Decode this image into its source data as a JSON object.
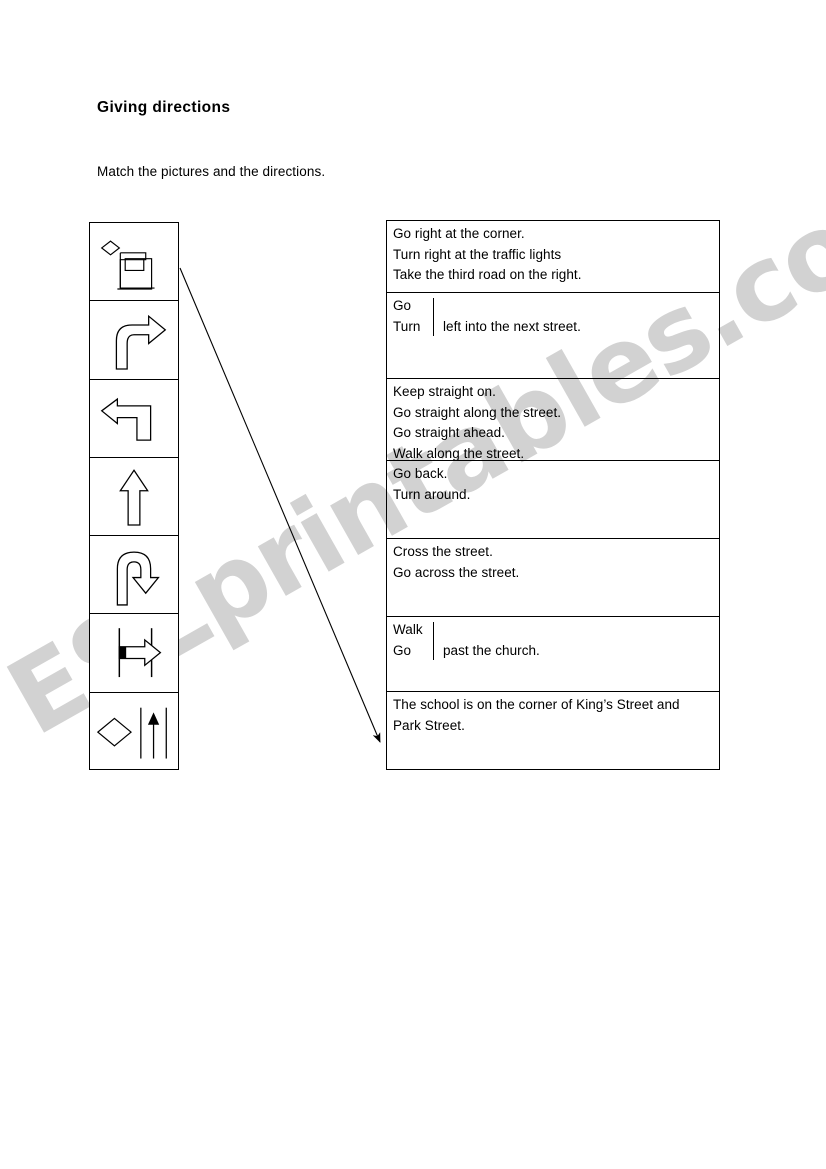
{
  "worksheet": {
    "title": "Giving directions",
    "instruction": "Match the pictures and the directions."
  },
  "watermark": {
    "text": "ESLprintables.com",
    "color": "#d2d2d2"
  },
  "pictures": {
    "items": [
      {
        "id": "pic-corner-right-turn",
        "alt": "Road turning right at a corner with a building marker"
      },
      {
        "id": "pic-curved-right-arrow",
        "alt": "Curved arrow turning right"
      },
      {
        "id": "pic-left-turn-arrow",
        "alt": "Arrow turning left"
      },
      {
        "id": "pic-straight-ahead-arrow",
        "alt": "Arrow pointing straight up"
      },
      {
        "id": "pic-u-turn-arrow",
        "alt": "U-turn arrow"
      },
      {
        "id": "pic-cross-street-arrow",
        "alt": "Arrow crossing between two street lines"
      },
      {
        "id": "pic-building-on-corner",
        "alt": "Building beside a street with an arrow going past it"
      }
    ]
  },
  "directions": {
    "cells": [
      {
        "id": "direction-cell-1",
        "type": "lines",
        "lines": [
          "Go right at the corner.",
          "Turn right at the traffic lights",
          "Take the third road on the right."
        ]
      },
      {
        "id": "direction-cell-2",
        "type": "brace",
        "options": [
          "Go",
          "Turn"
        ],
        "tail": "left into the next street."
      },
      {
        "id": "direction-cell-3",
        "type": "lines",
        "lines": [
          "Keep straight on.",
          "Go straight along the street.",
          "Go straight ahead.",
          "Walk along the street."
        ]
      },
      {
        "id": "direction-cell-4",
        "type": "lines",
        "lines": [
          "Go back.",
          "Turn around."
        ]
      },
      {
        "id": "direction-cell-5",
        "type": "lines",
        "lines": [
          "Cross the street.",
          "Go across the street."
        ]
      },
      {
        "id": "direction-cell-6",
        "type": "brace",
        "options": [
          "Walk",
          "Go"
        ],
        "tail": "past the church."
      },
      {
        "id": "direction-cell-7",
        "type": "lines",
        "lines": [
          "The school is on the corner of King’s Street and",
          "Park Street."
        ]
      }
    ]
  },
  "connector": {
    "id": "match-line-1",
    "from_picture": 1,
    "to_direction_cell": 7
  }
}
